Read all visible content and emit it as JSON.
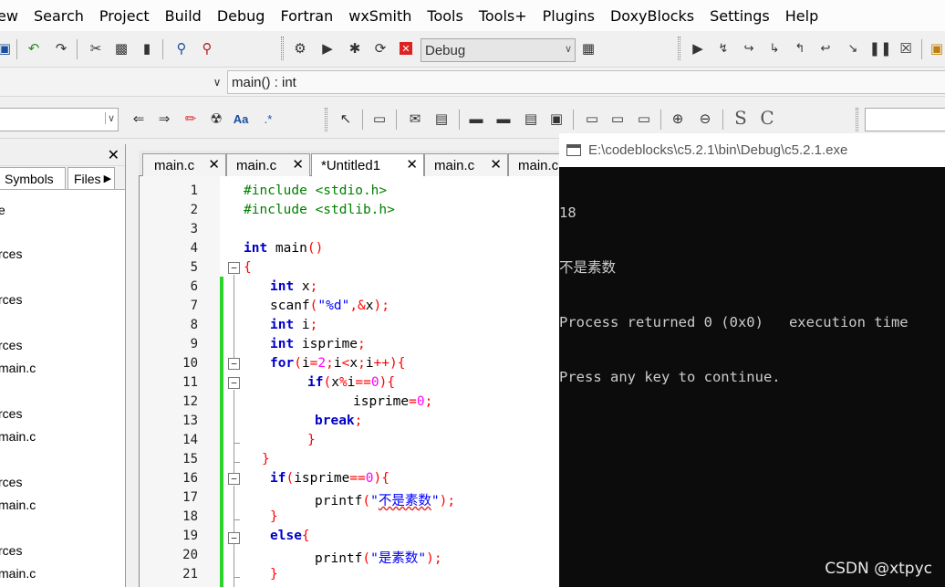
{
  "menu": [
    "ew",
    "Search",
    "Project",
    "Build",
    "Debug",
    "Fortran",
    "wxSmith",
    "Tools",
    "Tools+",
    "Plugins",
    "DoxyBlocks",
    "Settings",
    "Help"
  ],
  "toolbar": {
    "build_target": "Debug",
    "function_scope": "main() : int"
  },
  "left_panel": {
    "tabs": [
      "Symbols",
      "Files"
    ],
    "tree_items": [
      "e",
      "rces",
      "rces",
      "rces",
      "main.c",
      "rces",
      "main.c",
      "rces",
      "main.c",
      "rces",
      "main.c"
    ]
  },
  "editor_tabs": [
    "main.c",
    "main.c",
    "*Untitled1",
    "main.c",
    "main.c"
  ],
  "line_numbers": [
    "1",
    "2",
    "3",
    "4",
    "5",
    "6",
    "7",
    "8",
    "9",
    "10",
    "11",
    "12",
    "13",
    "14",
    "15",
    "16",
    "17",
    "18",
    "19",
    "20",
    "21"
  ],
  "code_lines": {
    "l1": "#include <stdio.h>",
    "l2": "#include <stdlib.h>",
    "l4a": "int",
    "l4b": " main",
    "l4c": "()",
    "l5": "{",
    "l6a": "int",
    "l6b": " x",
    "l6c": ";",
    "l7a": "scanf",
    "l7b": "(",
    "l7c": "\"%d\"",
    "l7d": ",&",
    "l7e": "x",
    "l7f": ");",
    "l8a": "int",
    "l8b": " i",
    "l8c": ";",
    "l9a": "int",
    "l9b": " isprime",
    "l9c": ";",
    "l10a": "for",
    "l10b": "(",
    "l10c": "i",
    "l10d": "=",
    "l10e": "2",
    "l10f": ";",
    "l10g": "i",
    "l10h": "<",
    "l10i": "x",
    "l10j": ";",
    "l10k": "i",
    "l10l": "++){",
    "l11a": "if",
    "l11b": "(",
    "l11c": "x",
    "l11d": "%",
    "l11e": "i",
    "l11f": "==",
    "l11g": "0",
    "l11h": "){",
    "l12a": "isprime",
    "l12b": "=",
    "l12c": "0",
    "l12d": ";",
    "l13a": "break",
    "l13b": ";",
    "l14": "}",
    "l15": "}",
    "l16a": "if",
    "l16b": "(",
    "l16c": "isprime",
    "l16d": "==",
    "l16e": "0",
    "l16f": "){",
    "l17a": "printf",
    "l17b": "(",
    "l17c": "\"",
    "l17d": "不是素数",
    "l17e": "\"",
    "l17f": ");",
    "l18": "}",
    "l19a": "else",
    "l19b": "{",
    "l20a": "printf",
    "l20b": "(",
    "l20c": "\"",
    "l20d": "是素数",
    "l20e": "\"",
    "l20f": ");",
    "l21": "}"
  },
  "console": {
    "title": "E:\\codeblocks\\c5.2.1\\bin\\Debug\\c5.2.1.exe",
    "lines": [
      "18",
      "不是素数",
      "Process returned 0 (0x0)   execution time",
      "Press any key to continue."
    ]
  },
  "watermark": "CSDN @xtpyc"
}
